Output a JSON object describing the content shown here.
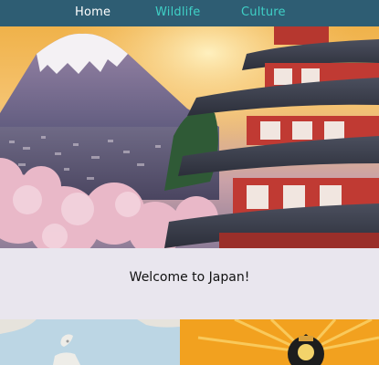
{
  "nav": {
    "items": [
      {
        "label": "Home"
      },
      {
        "label": "Wildlife"
      },
      {
        "label": "Culture"
      }
    ]
  },
  "welcome": {
    "title": "Welcome to Japan!"
  },
  "colors": {
    "nav_background": "#2e5d73",
    "nav_active_text": "#ffffff",
    "nav_link_text": "#3fd0c6",
    "page_background": "#e9e6ee"
  }
}
